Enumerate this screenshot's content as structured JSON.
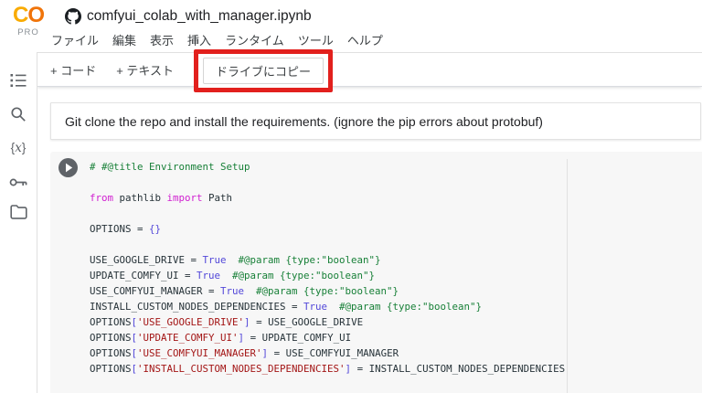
{
  "header": {
    "logo_text_c": "C",
    "logo_text_o": "O",
    "logo_badge": "PRO",
    "title": "comfyui_colab_with_manager.ipynb",
    "menu_items": [
      {
        "id": "file",
        "label": "ファイル"
      },
      {
        "id": "edit",
        "label": "編集"
      },
      {
        "id": "view",
        "label": "表示"
      },
      {
        "id": "insert",
        "label": "挿入"
      },
      {
        "id": "runtime",
        "label": "ランタイム"
      },
      {
        "id": "tools",
        "label": "ツール"
      },
      {
        "id": "help",
        "label": "ヘルプ"
      }
    ]
  },
  "toolbar": {
    "add_code_label": "+ コード",
    "add_text_label": "+ テキスト",
    "copy_to_drive_label": "ドライブにコピー"
  },
  "sidebar": {
    "variables_icon_text_open": "{",
    "variables_icon_text_x": "x",
    "variables_icon_text_close": "}"
  },
  "markdown_cell": {
    "text": "Git clone the repo and install the requirements. (ignore the pip errors about protobuf)"
  },
  "code_cell": {
    "lines": [
      [
        [
          "c",
          "# #@title Environment Setup"
        ]
      ],
      [],
      [
        [
          "k",
          "from"
        ],
        [
          "p",
          " pathlib "
        ],
        [
          "k",
          "import"
        ],
        [
          "p",
          " Path"
        ]
      ],
      [],
      [
        [
          "p",
          "OPTIONS = "
        ],
        [
          "br",
          "{}"
        ]
      ],
      [],
      [
        [
          "p",
          "USE_GOOGLE_DRIVE = "
        ],
        [
          "b",
          "True"
        ],
        [
          "p",
          "  "
        ],
        [
          "c",
          "#@param {type:\"boolean\"}"
        ]
      ],
      [
        [
          "p",
          "UPDATE_COMFY_UI = "
        ],
        [
          "b",
          "True"
        ],
        [
          "p",
          "  "
        ],
        [
          "c",
          "#@param {type:\"boolean\"}"
        ]
      ],
      [
        [
          "p",
          "USE_COMFYUI_MANAGER = "
        ],
        [
          "b",
          "True"
        ],
        [
          "p",
          "  "
        ],
        [
          "c",
          "#@param {type:\"boolean\"}"
        ]
      ],
      [
        [
          "p",
          "INSTALL_CUSTOM_NODES_DEPENDENCIES = "
        ],
        [
          "b",
          "True"
        ],
        [
          "p",
          "  "
        ],
        [
          "c",
          "#@param {type:\"boolean\"}"
        ]
      ],
      [
        [
          "p",
          "OPTIONS"
        ],
        [
          "br",
          "["
        ],
        [
          "s",
          "'USE_GOOGLE_DRIVE'"
        ],
        [
          "br",
          "]"
        ],
        [
          "p",
          " = USE_GOOGLE_DRIVE"
        ]
      ],
      [
        [
          "p",
          "OPTIONS"
        ],
        [
          "br",
          "["
        ],
        [
          "s",
          "'UPDATE_COMFY_UI'"
        ],
        [
          "br",
          "]"
        ],
        [
          "p",
          " = UPDATE_COMFY_UI"
        ]
      ],
      [
        [
          "p",
          "OPTIONS"
        ],
        [
          "br",
          "["
        ],
        [
          "s",
          "'USE_COMFYUI_MANAGER'"
        ],
        [
          "br",
          "]"
        ],
        [
          "p",
          " = USE_COMFYUI_MANAGER"
        ]
      ],
      [
        [
          "p",
          "OPTIONS"
        ],
        [
          "br",
          "["
        ],
        [
          "s",
          "'INSTALL_CUSTOM_NODES_DEPENDENCIES'"
        ],
        [
          "br",
          "]"
        ],
        [
          "p",
          " = INSTALL_CUSTOM_NODES_DEPENDENCIES"
        ]
      ]
    ]
  },
  "colors": {
    "annotation_red": "#e2201d",
    "logo_orange_c": "#f9ab00",
    "logo_orange_o": "#f0740a",
    "comment_green": "#188038",
    "keyword_magenta": "#d01fd0",
    "boolean_indigo": "#5247d9",
    "string_red": "#a31515",
    "icon_gray": "#5f6368"
  }
}
